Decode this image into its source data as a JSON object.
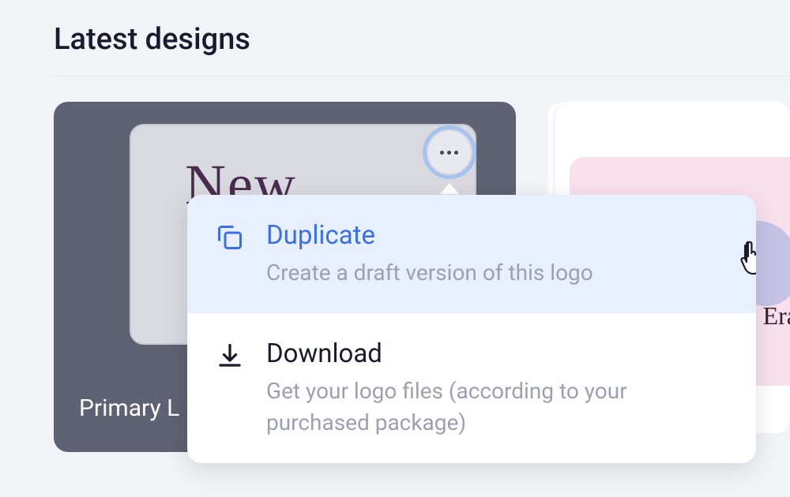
{
  "section": {
    "title": "Latest designs"
  },
  "primary_card": {
    "label": "Primary L",
    "inner_text": "New"
  },
  "secondary_card": {
    "brand_text": "Era"
  },
  "dropdown": {
    "items": [
      {
        "title": "Duplicate",
        "desc": "Create a draft version of this logo"
      },
      {
        "title": "Download",
        "desc": "Get your logo files (according to your purchased package)"
      }
    ]
  }
}
